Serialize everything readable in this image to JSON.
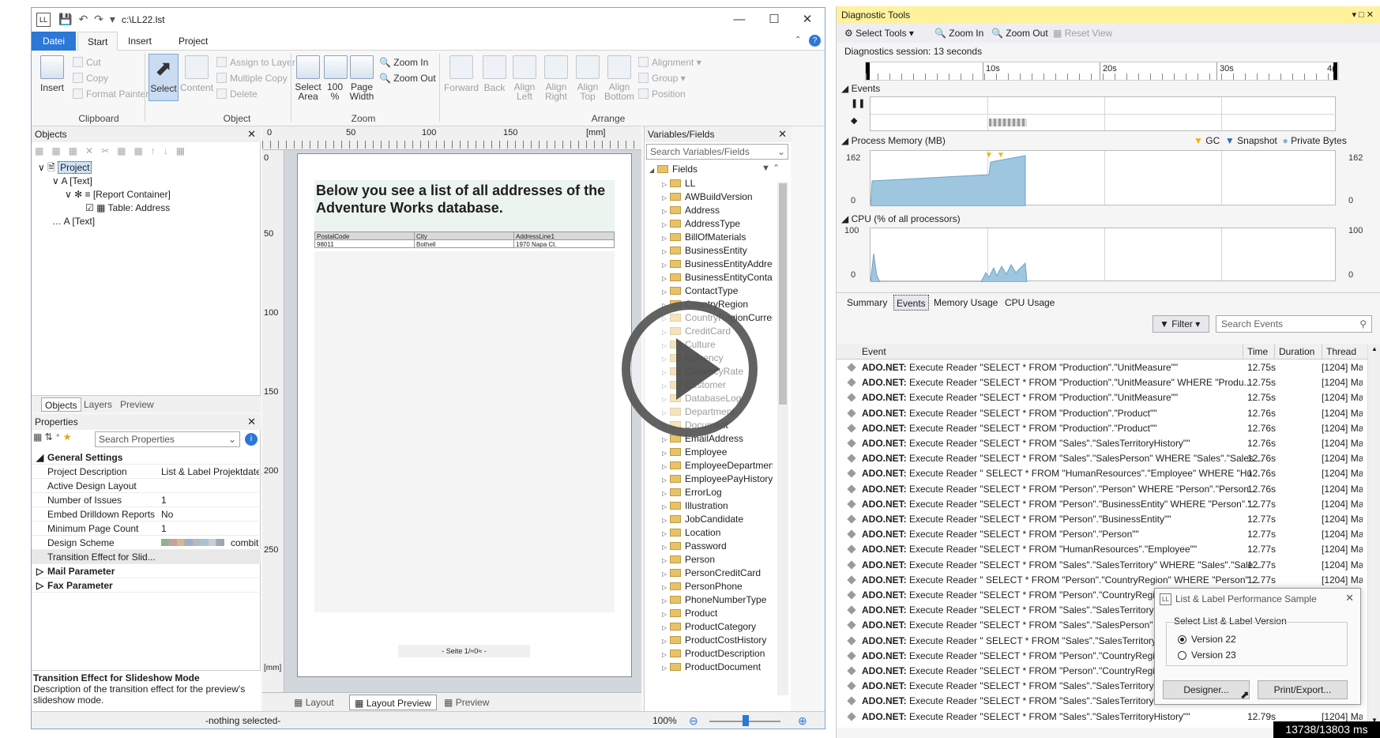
{
  "ll": {
    "title_path": "c:\\LL22.lst",
    "ribbon_tabs": [
      "Datei",
      "Start",
      "Insert",
      "Project"
    ],
    "clipboard": {
      "insert": "Insert",
      "cut": "Cut",
      "copy": "Copy",
      "format_painter": "Format Painter",
      "label": "Clipboard"
    },
    "object_group": {
      "select": "Select",
      "content": "Content",
      "assign_layer": "Assign to Layer",
      "multiple_copy": "Multiple Copy",
      "delete": "Delete",
      "label": "Object"
    },
    "zoom_group": {
      "select_area": "Select Area",
      "zoom_100": "100 %",
      "page_width": "Page Width",
      "zoom_in": "Zoom In",
      "zoom_out": "Zoom Out",
      "label": "Zoom"
    },
    "arrange_group": {
      "forward": "Forward",
      "back": "Back",
      "align_left": "Align Left",
      "align_right": "Align Right",
      "align_top": "Align Top",
      "align_bottom": "Align Bottom",
      "alignment": "Alignment",
      "group": "Group",
      "position": "Position",
      "label": "Arrange"
    },
    "objects_panel": {
      "title": "Objects",
      "tree": [
        "Project",
        "[Text]",
        "[Report Container]",
        "Table: Address",
        "[Text]"
      ]
    },
    "panel_tabs": [
      "Objects",
      "Layers",
      "Preview"
    ],
    "properties_panel": {
      "title": "Properties",
      "search_placeholder": "Search Properties",
      "category_general": "General Settings",
      "rows": [
        {
          "key": "Project Description",
          "value": "List & Label Projektdatei"
        },
        {
          "key": "Active Design Layout",
          "value": ""
        },
        {
          "key": "Number of Issues",
          "value": "1"
        },
        {
          "key": "Embed Drilldown Reports",
          "value": "No"
        },
        {
          "key": "Minimum Page Count",
          "value": "1"
        },
        {
          "key": "Design Scheme",
          "value": "combit"
        },
        {
          "key": "Transition Effect for Slid...",
          "value": ""
        }
      ],
      "category_mail": "Mail Parameter",
      "category_fax": "Fax Parameter",
      "desc_title": "Transition Effect for Slideshow Mode",
      "desc_text": "Description of the transition effect for the preview's slideshow mode."
    },
    "ruler_top": [
      "0",
      "50",
      "100",
      "150",
      "[mm]"
    ],
    "ruler_left": [
      "0",
      "50",
      "100",
      "150",
      "200",
      "250",
      "[mm]"
    ],
    "page": {
      "heading": "Below you see a list of all addresses of the Adventure Works database.",
      "table_headers": [
        "PostalCode",
        "City",
        "AddressLine1"
      ],
      "table_row": [
        "98011",
        "Bothell",
        "1970 Napa Ct."
      ],
      "footer": "- Seite 1/≈0≈ -"
    },
    "doc_tabs": [
      "Layout",
      "Layout Preview",
      "Preview"
    ],
    "vars_panel": {
      "title": "Variables/Fields",
      "search_placeholder": "Search Variables/Fields",
      "root": "Fields",
      "items": [
        "LL",
        "AWBuildVersion",
        "Address",
        "AddressType",
        "BillOfMaterials",
        "BusinessEntity",
        "BusinessEntityAddress",
        "BusinessEntityContact",
        "ContactType",
        "CountryRegion",
        "CountryRegionCurrency",
        "CreditCard",
        "Culture",
        "Currency",
        "CurrencyRate",
        "Customer",
        "DatabaseLog",
        "Department",
        "Document",
        "EmailAddress",
        "Employee",
        "EmployeeDepartmentHistory",
        "EmployeePayHistory",
        "ErrorLog",
        "Illustration",
        "JobCandidate",
        "Location",
        "Password",
        "Person",
        "PersonCreditCard",
        "PersonPhone",
        "PhoneNumberType",
        "Product",
        "ProductCategory",
        "ProductCostHistory",
        "ProductDescription",
        "ProductDocument"
      ]
    },
    "status": {
      "selection": "-nothing selected-",
      "zoom": "100%"
    }
  },
  "diag": {
    "title": "Diagnostic Tools",
    "toolbar": {
      "select_tools": "Select Tools",
      "zoom_in": "Zoom In",
      "zoom_out": "Zoom Out",
      "reset_view": "Reset View"
    },
    "session": "Diagnostics session: 13 seconds",
    "timeline_ticks": [
      "10s",
      "20s",
      "30s",
      "4("
    ],
    "events_label": "Events",
    "memory_label": "Process Memory (MB)",
    "legend": [
      "GC",
      "Snapshot",
      "Private Bytes"
    ],
    "memory_axis": [
      "162",
      "0",
      "162",
      "0"
    ],
    "cpu_label": "CPU (% of all processors)",
    "cpu_axis": [
      "100",
      "0",
      "100",
      "0"
    ],
    "tabs": [
      "Summary",
      "Events",
      "Memory Usage",
      "CPU Usage"
    ],
    "filter": "Filter",
    "search_placeholder": "Search Events",
    "columns": [
      "Event",
      "Time",
      "Duration",
      "Thread"
    ],
    "events": [
      {
        "src": "ADO.NET:",
        "text": " Execute Reader \"SELECT * FROM \"Production\".\"UnitMeasure\"\"",
        "time": "12.75s",
        "thread": "[1204] Ma"
      },
      {
        "src": "ADO.NET:",
        "text": " Execute Reader \"SELECT * FROM \"Production\".\"UnitMeasure\" WHERE \"Produ...",
        "time": "12.75s",
        "thread": "[1204] Ma"
      },
      {
        "src": "ADO.NET:",
        "text": " Execute Reader \"SELECT * FROM \"Production\".\"UnitMeasure\"\"",
        "time": "12.75s",
        "thread": "[1204] Ma"
      },
      {
        "src": "ADO.NET:",
        "text": " Execute Reader \"SELECT * FROM \"Production\".\"Product\"\"",
        "time": "12.76s",
        "thread": "[1204] Ma"
      },
      {
        "src": "ADO.NET:",
        "text": " Execute Reader \"SELECT * FROM \"Production\".\"Product\"\"",
        "time": "12.76s",
        "thread": "[1204] Ma"
      },
      {
        "src": "ADO.NET:",
        "text": " Execute Reader \"SELECT * FROM \"Sales\".\"SalesTerritoryHistory\"\"",
        "time": "12.76s",
        "thread": "[1204] Ma"
      },
      {
        "src": "ADO.NET:",
        "text": " Execute Reader \"SELECT * FROM \"Sales\".\"SalesPerson\" WHERE \"Sales\".\"SalesP...",
        "time": "12.76s",
        "thread": "[1204] Ma"
      },
      {
        "src": "ADO.NET:",
        "text": " Execute Reader \" SELECT * FROM \"HumanResources\".\"Employee\" WHERE \"Hu...",
        "time": "12.76s",
        "thread": "[1204] Ma"
      },
      {
        "src": "ADO.NET:",
        "text": " Execute Reader \"SELECT * FROM \"Person\".\"Person\" WHERE \"Person\".\"Person...",
        "time": "12.76s",
        "thread": "[1204] Ma"
      },
      {
        "src": "ADO.NET:",
        "text": " Execute Reader \"SELECT * FROM \"Person\".\"BusinessEntity\" WHERE \"Person\".\"...",
        "time": "12.77s",
        "thread": "[1204] Ma"
      },
      {
        "src": "ADO.NET:",
        "text": " Execute Reader \"SELECT * FROM \"Person\".\"BusinessEntity\"\"",
        "time": "12.77s",
        "thread": "[1204] Ma"
      },
      {
        "src": "ADO.NET:",
        "text": " Execute Reader \"SELECT * FROM \"Person\".\"Person\"\"",
        "time": "12.77s",
        "thread": "[1204] Ma"
      },
      {
        "src": "ADO.NET:",
        "text": " Execute Reader \"SELECT * FROM \"HumanResources\".\"Employee\"\"",
        "time": "12.77s",
        "thread": "[1204] Ma"
      },
      {
        "src": "ADO.NET:",
        "text": " Execute Reader \"SELECT * FROM \"Sales\".\"SalesTerritory\" WHERE \"Sales\".\"Sales...",
        "time": "12.77s",
        "thread": "[1204] Ma"
      },
      {
        "src": "ADO.NET:",
        "text": " Execute Reader \" SELECT * FROM \"Person\".\"CountryRegion\" WHERE \"Person\"....",
        "time": "12.77s",
        "thread": "[1204] Ma"
      },
      {
        "src": "ADO.NET:",
        "text": " Execute Reader \"SELECT * FROM \"Person\".\"CountryRegion\"",
        "time": "",
        "thread": ""
      },
      {
        "src": "ADO.NET:",
        "text": " Execute Reader \"SELECT * FROM \"Sales\".\"SalesTerritory\"",
        "time": "",
        "thread": ""
      },
      {
        "src": "ADO.NET:",
        "text": " Execute Reader \"SELECT * FROM \"Sales\".\"SalesPerson\"",
        "time": "",
        "thread": ""
      },
      {
        "src": "ADO.NET:",
        "text": " Execute Reader \" SELECT * FROM \"Sales\".\"SalesTerritory\" W",
        "time": "",
        "thread": ""
      },
      {
        "src": "ADO.NET:",
        "text": " Execute Reader \"SELECT * FROM \"Person\".\"CountryRegion\"",
        "time": "",
        "thread": ""
      },
      {
        "src": "ADO.NET:",
        "text": " Execute Reader \"SELECT * FROM \"Person\".\"CountryRegion\"",
        "time": "",
        "thread": ""
      },
      {
        "src": "ADO.NET:",
        "text": " Execute Reader \"SELECT * FROM \"Sales\".\"SalesTerritory\"\"",
        "time": "",
        "thread": ""
      },
      {
        "src": "ADO.NET:",
        "text": " Execute Reader \"SELECT * FROM \"Sales\".\"SalesTerritoryHisto",
        "time": "",
        "thread": ""
      },
      {
        "src": "ADO.NET:",
        "text": " Execute Reader \"SELECT * FROM \"Sales\".\"SalesTerritoryHistory\"\"",
        "time": "12.79s",
        "thread": "[1204] Ma"
      }
    ]
  },
  "sample_dialog": {
    "title": "List & Label Performance Sample",
    "group_label": "Select List & Label Version",
    "options": [
      "Version 22",
      "Version 23"
    ],
    "designer": "Designer...",
    "print": "Print/Export..."
  },
  "overlay": {
    "time": "13738/13803 ms"
  }
}
